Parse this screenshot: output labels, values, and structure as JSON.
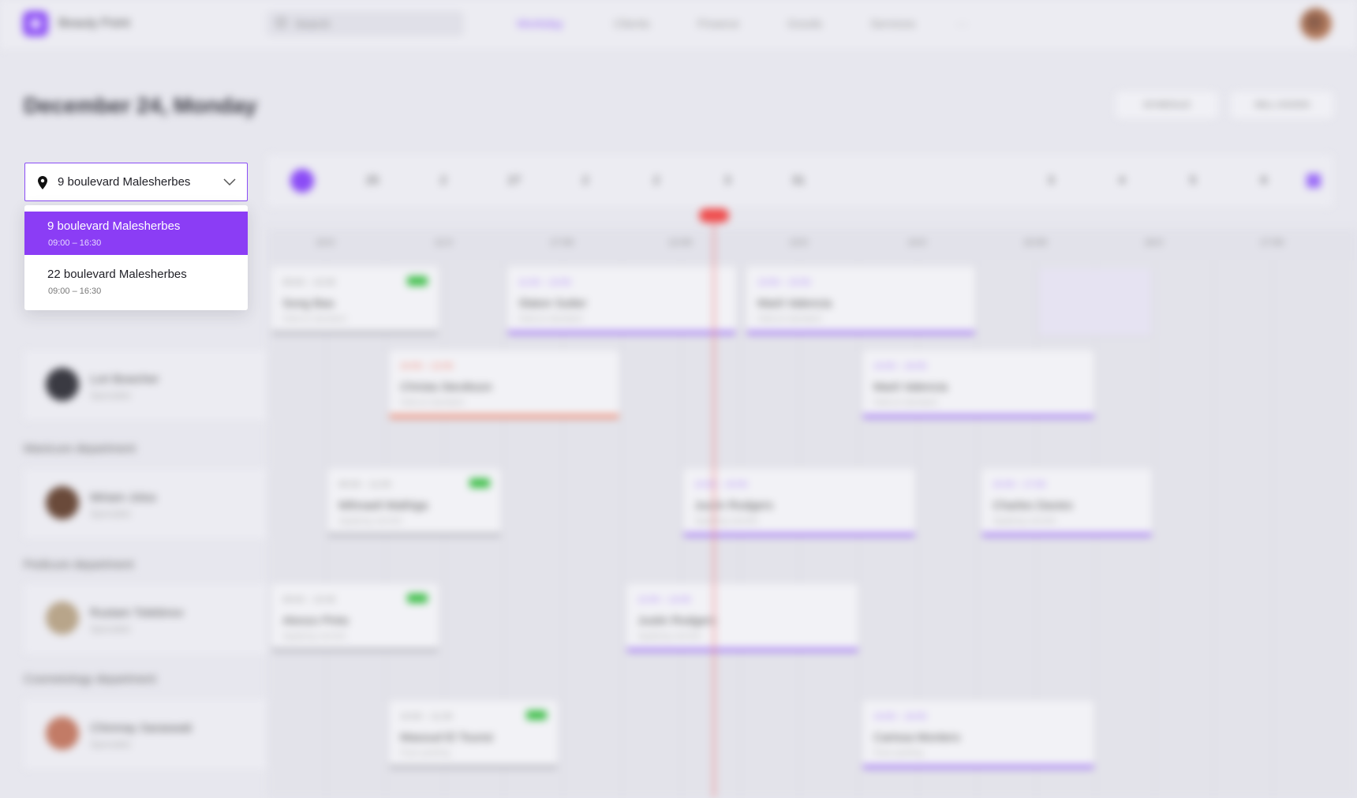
{
  "app": {
    "brand": "Beauty Point",
    "search_placeholder": "Search",
    "nav": [
      "Workday",
      "Clients",
      "Finance",
      "Goods",
      "Services",
      "···"
    ]
  },
  "page": {
    "title": "December 24, Monday",
    "buttons": [
      "SCHEDULE",
      "SELL GOODS"
    ]
  },
  "date_strip": {
    "dates": [
      "",
      "25",
      "2",
      "27",
      "2",
      "2",
      "3",
      "31",
      "",
      "",
      "",
      "3",
      "4",
      "5",
      "6"
    ]
  },
  "time_header": {
    "labels": [
      "10:0",
      "11:0",
      "17:00",
      "12:00",
      "13:0",
      "14:0",
      "15:00",
      "16:0",
      "17:00"
    ]
  },
  "departments": [
    "Manicure department",
    "Pedicure department",
    "Cosmetology department"
  ],
  "staff": [
    {
      "name": "Lori Bowcher",
      "role": "Specialist"
    },
    {
      "name": "Miriam Jolus",
      "role": "Specialist"
    },
    {
      "name": "Rustam Tolebinov",
      "role": "Specialist"
    },
    {
      "name": "Chinmay Saraswati",
      "role": "Specialist"
    }
  ],
  "appointments": [
    {
      "time": "09:00 – 10:30",
      "client": "Song Bao",
      "service": "Haircut standard"
    },
    {
      "time": "11:00 – 13:00",
      "client": "Slaton Sutter",
      "service": "Haircut standard"
    },
    {
      "time": "13:00 – 15:00",
      "client": "Marit Valencia",
      "service": "Haircut standard"
    },
    {
      "time": "10:00 – 12:00",
      "client": "Christa Stevikson",
      "service": "Haircut standard"
    },
    {
      "time": "14:00 – 16:00",
      "client": "Marit Valencia",
      "service": "Haircut standard"
    },
    {
      "time": "09:30 – 11:00",
      "client": "Mihnaeli Mathiga",
      "service": "Applying varnish"
    },
    {
      "time": "13:00 – 15:00",
      "client": "Justin Rodgers",
      "service": "Applying varnish"
    },
    {
      "time": "15:30 – 17:00",
      "client": "Charles Davies",
      "service": "Applying varnish"
    },
    {
      "time": "09:00 – 10:30",
      "client": "Alonzo Pinto",
      "service": "Applying varnish"
    },
    {
      "time": "12:00 – 14:00",
      "client": "Justin Rodgers",
      "service": "Applying varnish"
    },
    {
      "time": "10:00 – 11:30",
      "client": "Masoud El Tounsi",
      "service": "Face peeling"
    },
    {
      "time": "14:00 – 16:00",
      "client": "Carissa Montero",
      "service": "Face peeling"
    }
  ],
  "location_select": {
    "current": "9 boulevard Malesherbes",
    "options": [
      {
        "name": "9 boulevard Malesherbes",
        "hours": "09:00 – 16:30"
      },
      {
        "name": "22 boulevard Malesherbes",
        "hours": "09:00 – 16:30"
      }
    ]
  },
  "colors": {
    "accent": "#8b3df5",
    "now_line": "#ef4d4d",
    "paid_tag": "#3fbf4a"
  }
}
